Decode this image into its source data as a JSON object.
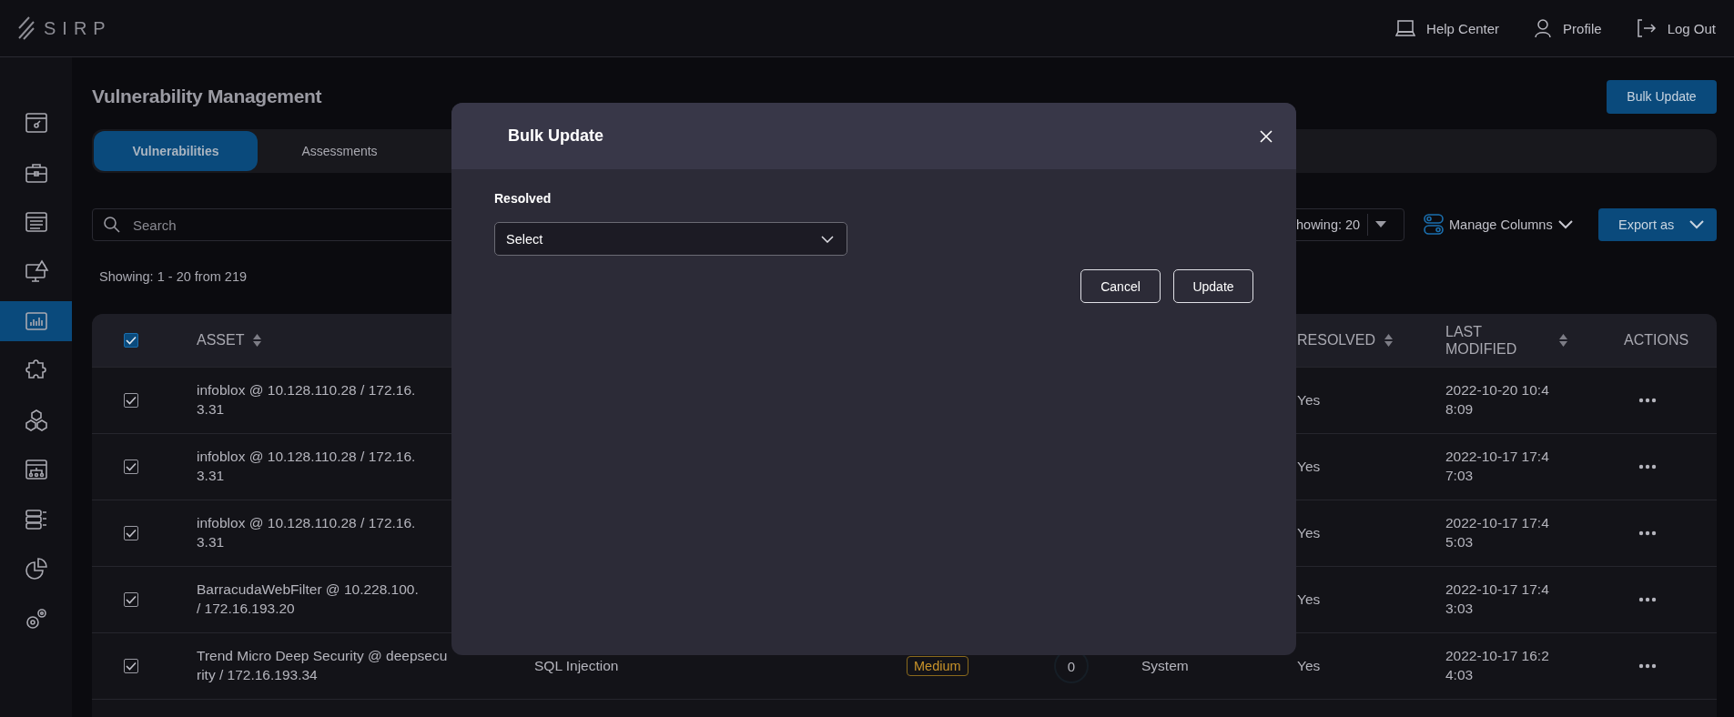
{
  "header": {
    "logo": "SIRP",
    "links": [
      {
        "label": "Help Center"
      },
      {
        "label": "Profile"
      },
      {
        "label": "Log Out"
      }
    ]
  },
  "sidebar": {
    "items": [
      {
        "selected": false
      },
      {
        "selected": false
      },
      {
        "selected": false
      },
      {
        "selected": false
      },
      {
        "selected": true
      },
      {
        "selected": false
      },
      {
        "selected": false
      },
      {
        "selected": false
      },
      {
        "selected": false
      },
      {
        "selected": false
      },
      {
        "selected": false
      }
    ]
  },
  "page": {
    "title": "Vulnerability Management",
    "bulk_update_button": "Bulk Update",
    "tabs": [
      {
        "label": "Vulnerabilities",
        "selected": true
      },
      {
        "label": "Assessments",
        "selected": false
      }
    ],
    "search": {
      "placeholder": "Search"
    },
    "page_size": {
      "value": "howing: 20"
    },
    "manage_columns": "Manage Columns",
    "export_button": "Export as",
    "count": "Showing: 1 - 20 from 219"
  },
  "table": {
    "select_all_checked": true,
    "columns": [
      {
        "kind": "asset",
        "label": "ASSET",
        "sortable": true
      },
      {
        "kind": "resolved",
        "label": "RESOLVED",
        "sortable": true
      },
      {
        "kind": "last_modified",
        "label": "LAST MODIFIED",
        "sortable": true
      },
      {
        "kind": "actions",
        "label": "ACTIONS",
        "sortable": false
      }
    ],
    "rows": [
      {
        "checked": true,
        "asset": [
          "infoblox @ 10.128.110.28 / 172.16.",
          "3.31"
        ],
        "resolved": "Yes",
        "last_modified": [
          "2022-10-20 10:4",
          "8:09"
        ]
      },
      {
        "checked": true,
        "asset": [
          "infoblox @ 10.128.110.28 / 172.16.",
          "3.31"
        ],
        "resolved": "Yes",
        "last_modified": [
          "2022-10-17 17:4",
          "7:03"
        ]
      },
      {
        "checked": true,
        "asset": [
          "infoblox @ 10.128.110.28 / 172.16.",
          "3.31"
        ],
        "resolved": "Yes",
        "last_modified": [
          "2022-10-17 17:4",
          "5:03"
        ]
      },
      {
        "checked": true,
        "asset": [
          "BarracudaWebFilter @ 10.228.100.",
          "/ 172.16.193.20"
        ],
        "resolved": "Yes",
        "last_modified": [
          "2022-10-17 17:4",
          "3:03"
        ]
      },
      {
        "checked": true,
        "asset": [
          "Trend Micro Deep Security @ deepsecu",
          "rity / 172.16.193.34"
        ],
        "vulnerability": "SQL Injection",
        "severity": "Medium",
        "score": "0",
        "reported_by": "System",
        "resolved": "Yes",
        "last_modified": [
          "2022-10-17 16:2",
          "4:03"
        ]
      }
    ]
  },
  "modal": {
    "title": "Bulk Update",
    "field_label": "Resolved",
    "select": {
      "value": "Select"
    },
    "buttons": [
      "Cancel",
      "Update"
    ]
  }
}
